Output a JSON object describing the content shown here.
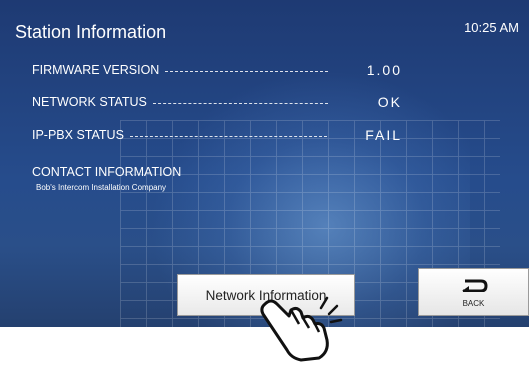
{
  "header": {
    "title": "Station Information",
    "time": "10:25 AM"
  },
  "info_rows": [
    {
      "label": "FIRMWARE VERSION",
      "value": "1.00"
    },
    {
      "label": "NETWORK STATUS",
      "value": "OK"
    },
    {
      "label": "IP-PBX STATUS",
      "value": "FAIL"
    }
  ],
  "contact": {
    "heading": "CONTACT INFORMATION",
    "company": "Bob's Intercom Installation Company"
  },
  "buttons": {
    "network_information": "Network Information",
    "back": "BACK"
  },
  "icons": {
    "back": "back-arrow-icon",
    "pointer": "pointing-hand-icon"
  },
  "colors": {
    "screen_background": "#264c8c",
    "text": "#ffffff",
    "button_background": "#f2f2f2"
  }
}
